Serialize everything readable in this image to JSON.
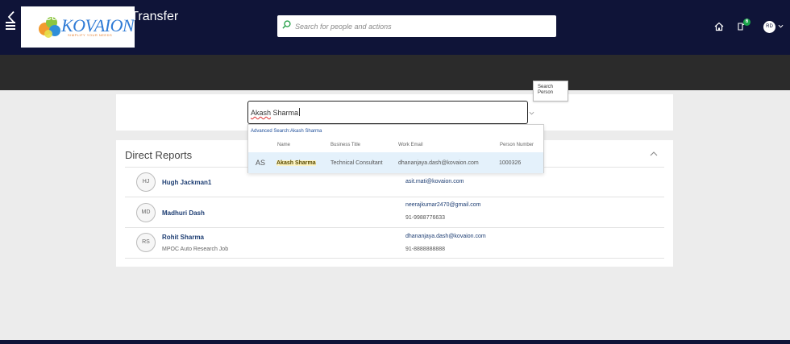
{
  "header": {
    "logo_text": "KOVAION",
    "logo_tagline": "SIMPLIFY YOUR NEEDS",
    "search_placeholder": "Search for people and actions",
    "notification_count": "6",
    "user_initials": "RD",
    "icons": [
      "menu-icon",
      "search-icon",
      "home-icon",
      "notification-icon",
      "chevron-down-icon"
    ]
  },
  "page": {
    "title": "Local and Global Transfer"
  },
  "person_search": {
    "value_first": "Akash",
    "value_rest": " Sharma",
    "tooltip_line1": "Search",
    "tooltip_line2": "Person"
  },
  "suggestions": {
    "advanced_link": "Advanced Search:Akash Sharma",
    "columns": [
      "Name",
      "Business Title",
      "Work Email",
      "Person Number"
    ],
    "rows": [
      {
        "initials": "AS",
        "name": "Akash Sharma",
        "title": "Technical Consultant",
        "email": "dhananjaya.dash@kovaion.com",
        "number": "1000326"
      }
    ]
  },
  "direct_reports": {
    "title": "Direct Reports",
    "items": [
      {
        "initials": "HJ",
        "name": "Hugh Jackman1",
        "job": "",
        "email": "asit.mati@kovaion.com",
        "phone": ""
      },
      {
        "initials": "MD",
        "name": "Madhuri Dash",
        "job": "",
        "email": "neerajkumar2470@gmail.com",
        "phone": "91-9988776633"
      },
      {
        "initials": "RS",
        "name": "Rohit Sharma",
        "job": "MPOC Auto Research Job",
        "email": "dhananjaya.dash@kovaion.com",
        "phone": "91-8888888888"
      }
    ]
  },
  "colors": {
    "header_bg": "#0f1438",
    "titlebar_bg": "#2b2b2b",
    "link": "#1e3e73",
    "highlight_row": "#e4f1fb"
  }
}
